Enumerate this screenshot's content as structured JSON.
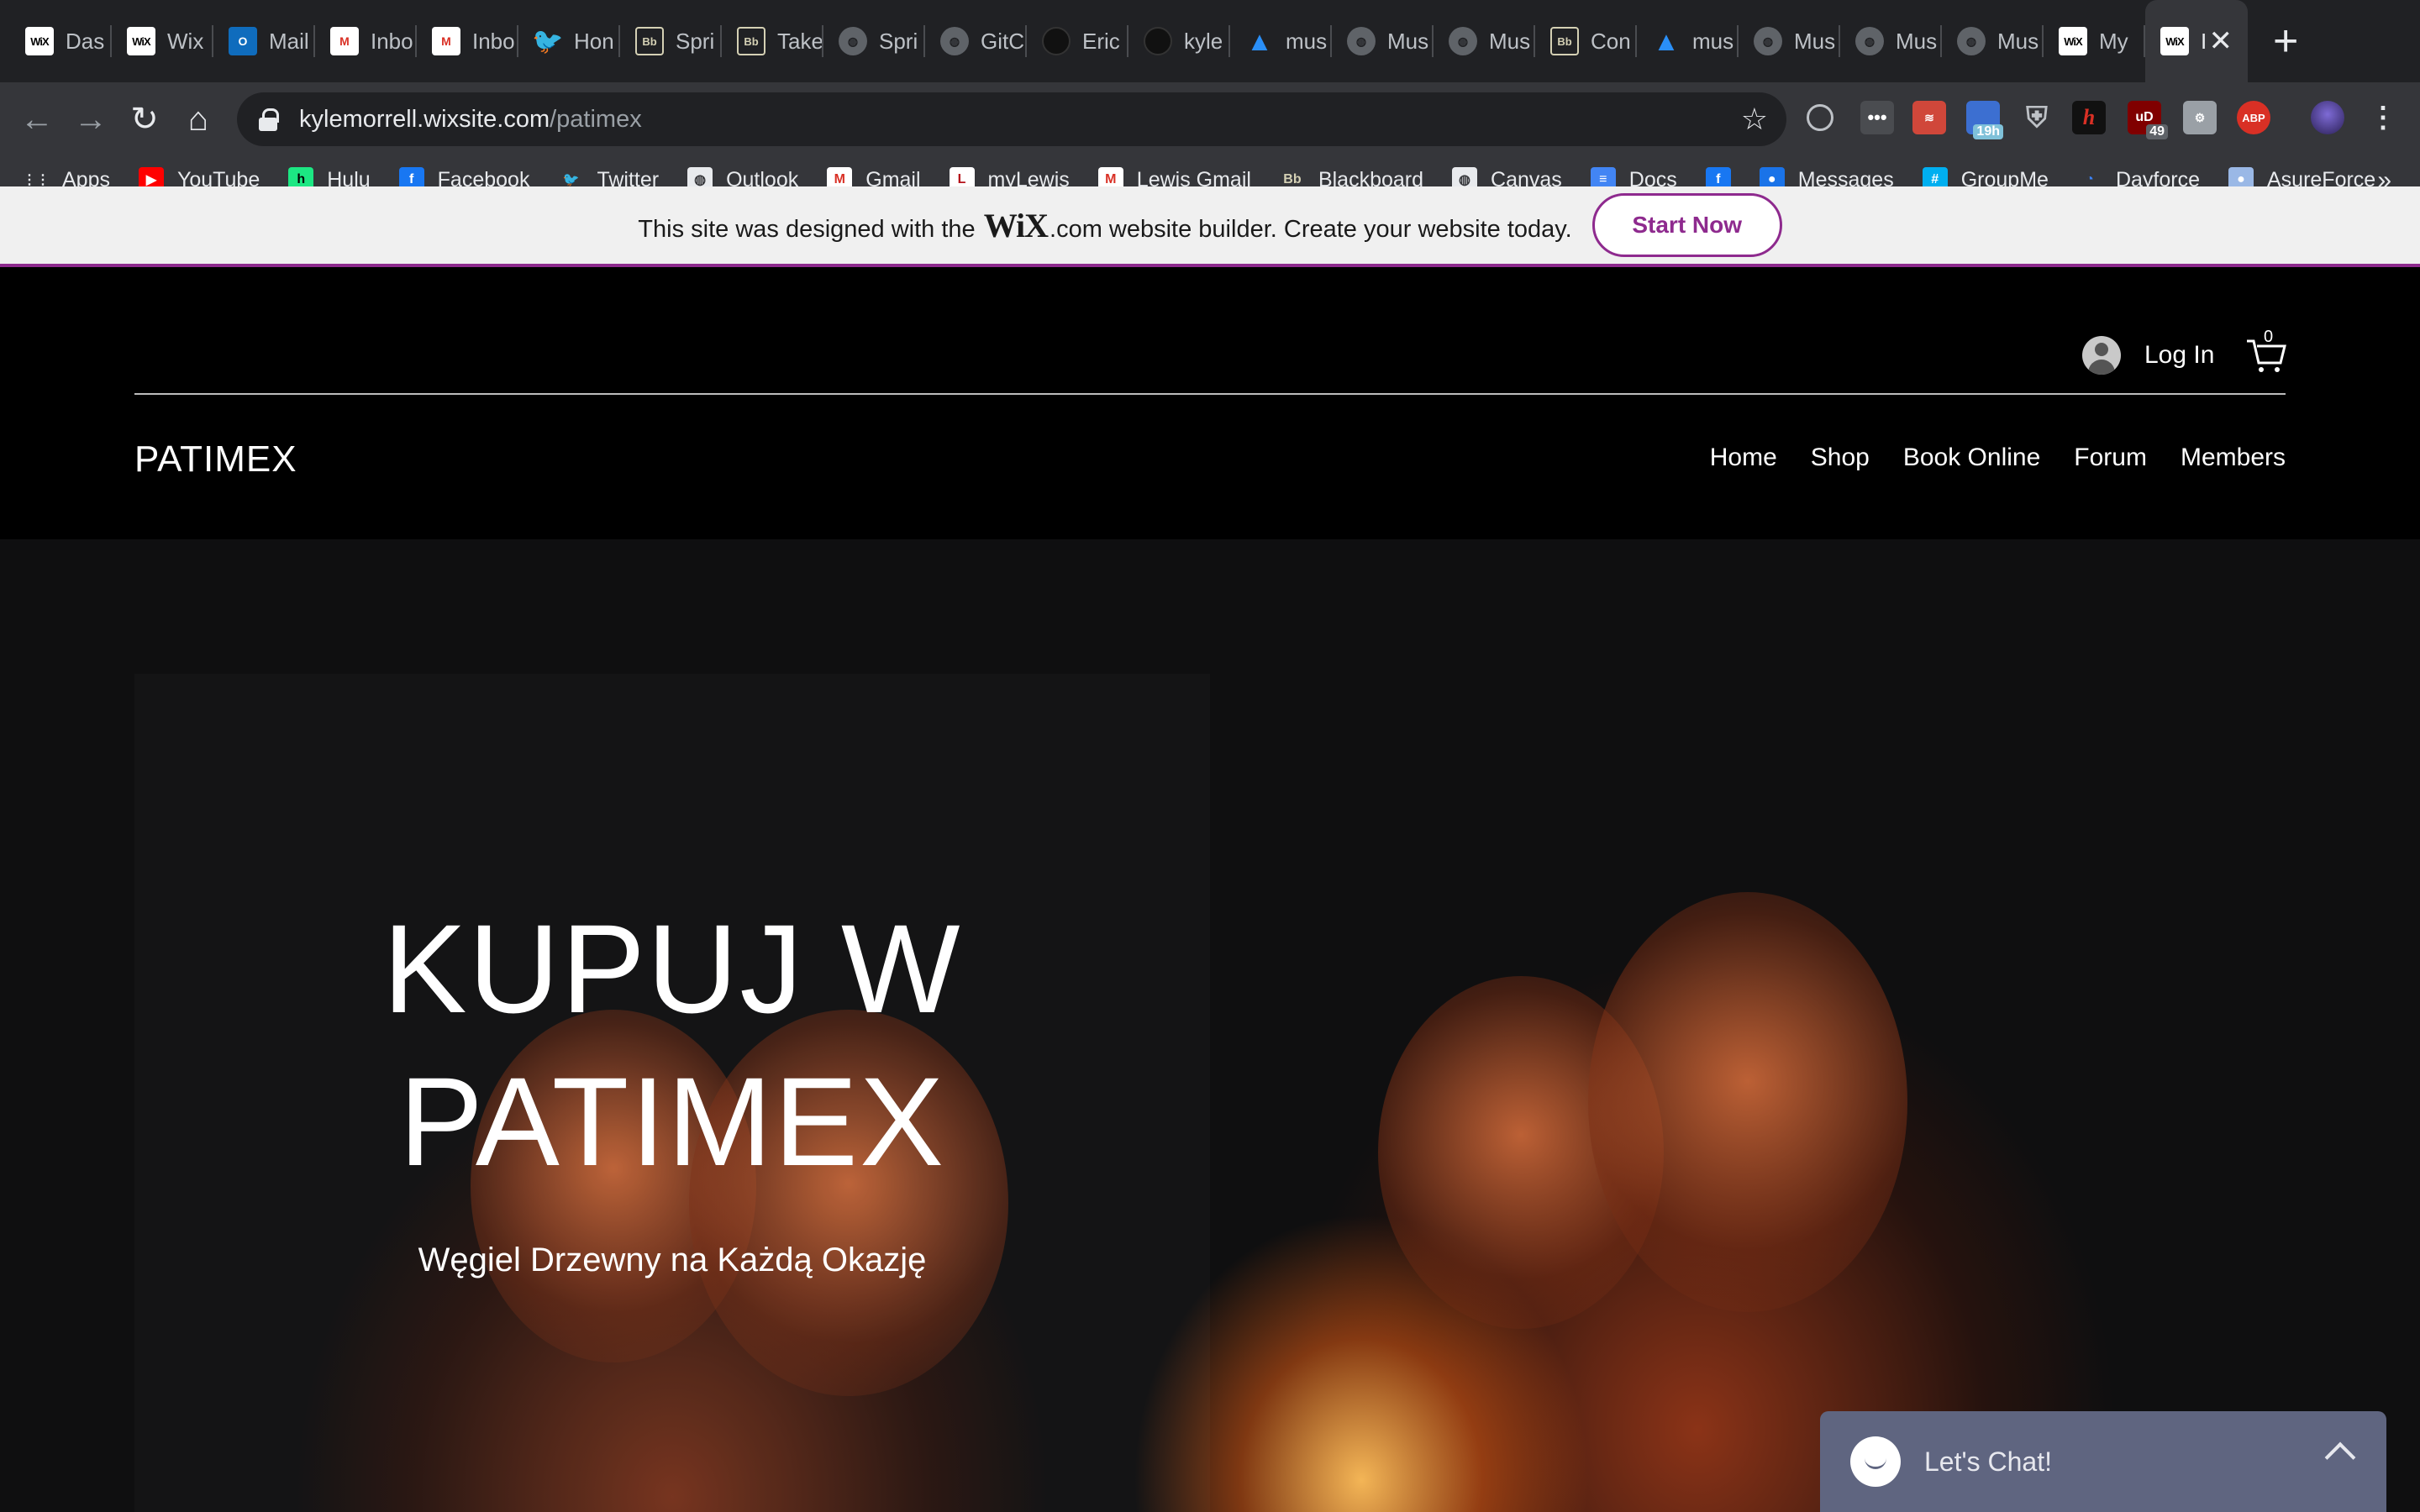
{
  "browser": {
    "tabs": [
      {
        "title": "Das",
        "icon": "wix-icon"
      },
      {
        "title": "Wix",
        "icon": "wix-icon"
      },
      {
        "title": "Mail",
        "icon": "outlook-icon"
      },
      {
        "title": "Inbo",
        "icon": "gmail-icon"
      },
      {
        "title": "Inbo",
        "icon": "gmail-icon"
      },
      {
        "title": "Hon",
        "icon": "twitter-icon"
      },
      {
        "title": "Spri",
        "icon": "blackboard-icon"
      },
      {
        "title": "Take",
        "icon": "blackboard-icon"
      },
      {
        "title": "Spri",
        "icon": "globe-icon"
      },
      {
        "title": "GitC",
        "icon": "globe-icon"
      },
      {
        "title": "Eric",
        "icon": "github-icon"
      },
      {
        "title": "kyle",
        "icon": "github-icon"
      },
      {
        "title": "mus",
        "icon": "azure-icon"
      },
      {
        "title": "Mus",
        "icon": "globe-icon"
      },
      {
        "title": "Mus",
        "icon": "globe-icon"
      },
      {
        "title": "Con",
        "icon": "blackboard-icon"
      },
      {
        "title": "mus",
        "icon": "azure-icon"
      },
      {
        "title": "Mus",
        "icon": "globe-icon"
      },
      {
        "title": "Mus",
        "icon": "globe-icon"
      },
      {
        "title": "Mus",
        "icon": "globe-icon"
      },
      {
        "title": "My",
        "icon": "wix-icon"
      },
      {
        "title": "I",
        "icon": "wix-icon",
        "active": true
      }
    ],
    "url": {
      "domain": "kylemorrell.wixsite.com",
      "path": "/patimex"
    },
    "bookmarks": [
      {
        "label": "Apps",
        "icon": "apps-grid-icon"
      },
      {
        "label": "YouTube",
        "icon": "youtube-icon"
      },
      {
        "label": "Hulu",
        "icon": "hulu-icon"
      },
      {
        "label": "Facebook",
        "icon": "facebook-icon"
      },
      {
        "label": "Twitter",
        "icon": "twitter-icon"
      },
      {
        "label": "Outlook",
        "icon": "globe-icon"
      },
      {
        "label": "Gmail",
        "icon": "gmail-icon"
      },
      {
        "label": "myLewis",
        "icon": "lewis-icon"
      },
      {
        "label": "Lewis Gmail",
        "icon": "gmail-icon"
      },
      {
        "label": "Blackboard",
        "icon": "blackboard-icon"
      },
      {
        "label": "Canvas",
        "icon": "globe-icon"
      },
      {
        "label": "Docs",
        "icon": "docs-icon"
      },
      {
        "label": "",
        "icon": "facebook-icon"
      },
      {
        "label": "Messages",
        "icon": "messages-icon"
      },
      {
        "label": "GroupMe",
        "icon": "groupme-icon"
      },
      {
        "label": "Dayforce",
        "icon": "dayforce-icon"
      },
      {
        "label": "AsureForce",
        "icon": "asureforce-icon"
      }
    ],
    "extensions": {
      "timer_badge": "19h",
      "ublock_badge": "49",
      "abp_label": "ABP"
    },
    "colors": {
      "tabstrip": "#202124",
      "toolbar": "#35363a"
    }
  },
  "wix_banner": {
    "message_pre": "This site was designed with the",
    "wix_logo": "WiX",
    "message_post": ".com website builder. Create your website today.",
    "cta": "Start Now",
    "accent": "#8e2a8e"
  },
  "site": {
    "brand": "PATIMEX",
    "login_label": "Log In",
    "cart_count": "0",
    "nav": [
      "Home",
      "Shop",
      "Book Online",
      "Forum",
      "Members"
    ]
  },
  "hero": {
    "title_line1": "KUPUJ W",
    "title_line2": "PATIMEX",
    "subtitle": "Węgiel Drzewny na Każdą Okazję"
  },
  "chat": {
    "label": "Let's Chat!"
  }
}
